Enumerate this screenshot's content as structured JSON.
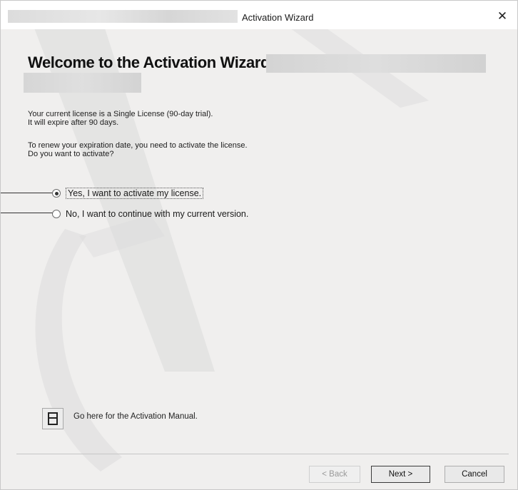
{
  "window": {
    "title": "Activation Wizard",
    "close_glyph": "✕"
  },
  "heading": "Welcome to the Activation Wizard for",
  "info": {
    "line1": "Your current license is a Single License (90-day trial).",
    "line2": "It will expire after 90 days.",
    "line3": "To renew your expiration date, you need to activate the license.",
    "line4": "Do you want to activate?"
  },
  "options": [
    {
      "label": "Yes, I want to activate my license.",
      "selected": true
    },
    {
      "label": "No, I want to continue with my current version.",
      "selected": false
    }
  ],
  "manual": {
    "icon": "document-icon",
    "link_text": "Go here for the Activation Manual."
  },
  "buttons": {
    "back": "< Back",
    "next": "Next >",
    "cancel": "Cancel"
  },
  "colors": {
    "window_bg": "#f0efee",
    "title_bg": "#ffffff",
    "watermark": "#d7d7d7"
  }
}
